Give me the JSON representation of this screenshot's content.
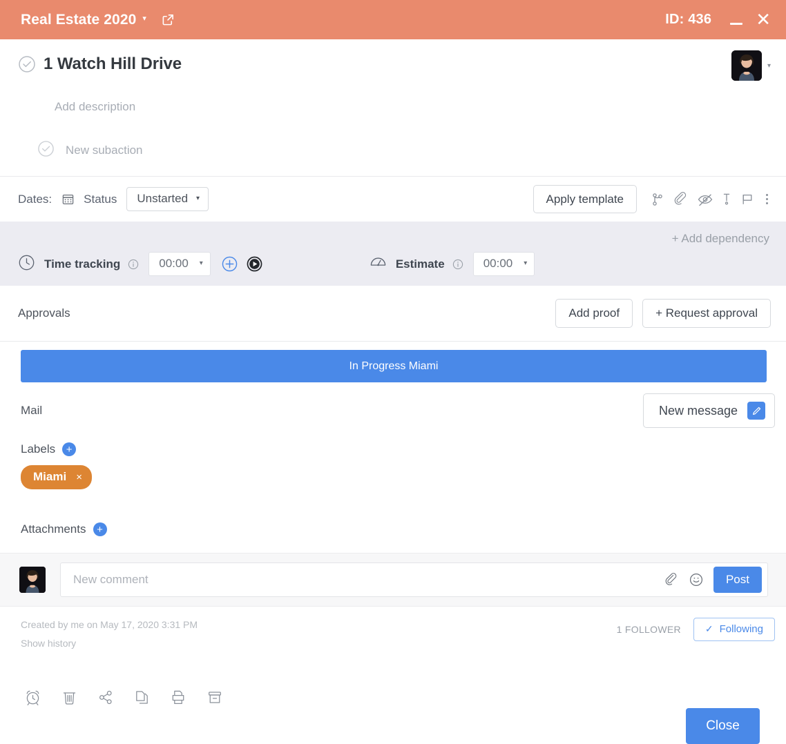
{
  "titlebar": {
    "project": "Real Estate 2020",
    "caret": "▾",
    "open_icon": "external-link-icon",
    "id_label": "ID: 436",
    "minimize_icon": "minimize-icon",
    "close_icon": "close-icon",
    "bg_color": "#e98a6d"
  },
  "task": {
    "complete_icon": "check-circle-icon",
    "title": "1 Watch Hill Drive",
    "assignee_avatar": "user-avatar",
    "assignee_caret": "▾",
    "description_placeholder": "Add description",
    "subaction_placeholder": "New subaction",
    "subaction_icon": "check-circle-icon"
  },
  "meta_bar": {
    "dates_label": "Dates:",
    "calendar_icon": "calendar-icon",
    "status_label": "Status",
    "status_value": "Unstarted",
    "status_caret": "▾",
    "apply_template": "Apply template",
    "icons": [
      "dependency-icon",
      "paperclip-icon",
      "eye-off-icon",
      "priority-icon",
      "flag-icon",
      "kebab-menu-icon"
    ]
  },
  "time_tracking": {
    "add_dependency": "+ Add dependency",
    "clock_icon": "clock-icon",
    "label": "Time tracking",
    "info_icon": "info-icon",
    "value": "00:00",
    "caret": "▾",
    "add_icon": "plus-circle-icon",
    "play_icon": "play-circle-icon",
    "estimate_icon": "gauge-icon",
    "estimate_label": "Estimate",
    "estimate_info_icon": "info-icon",
    "estimate_value": "00:00",
    "estimate_caret": "▾",
    "band_color": "#ececf2"
  },
  "approvals": {
    "label": "Approvals",
    "add_proof": "Add proof",
    "request_approval": "+ Request approval"
  },
  "banner": {
    "text": "In Progress Miami",
    "color": "#4a89e8"
  },
  "mail": {
    "label": "Mail",
    "new_message": "New message",
    "pen_icon": "pen-icon"
  },
  "labels": {
    "title": "Labels",
    "add_icon": "+",
    "chips": [
      {
        "text": "Miami",
        "remove_icon": "×",
        "color": "#dd8533"
      }
    ]
  },
  "attachments": {
    "title": "Attachments",
    "add_icon": "+"
  },
  "comment": {
    "avatar": "user-avatar",
    "placeholder": "New comment",
    "attach_icon": "paperclip-icon",
    "emoji_icon": "emoji-icon",
    "post_label": "Post"
  },
  "footer": {
    "created": "Created by me on May 17, 2020 3:31 PM",
    "show_history": "Show history",
    "followers": "1 FOLLOWER",
    "following_tick": "✓",
    "following_label": "Following"
  },
  "bottom_bar": {
    "icons": [
      "alarm-icon",
      "trash-icon",
      "share-icon",
      "duplicate-icon",
      "print-icon",
      "archive-icon"
    ],
    "close_label": "Close"
  }
}
